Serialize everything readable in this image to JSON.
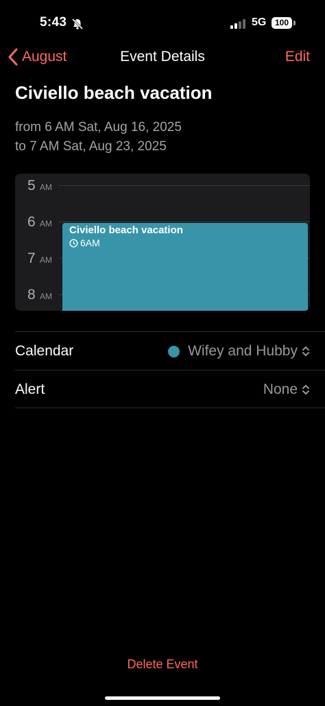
{
  "status": {
    "time": "5:43",
    "network": "5G",
    "battery": "100",
    "bell_icon": "bell-slash-icon",
    "signal_icon": "cellular-signal-icon"
  },
  "nav": {
    "back_label": "August",
    "title": "Event Details",
    "edit_label": "Edit",
    "back_icon": "chevron-left-icon"
  },
  "event": {
    "title": "Civiello beach vacation",
    "from": "from 6 AM Sat, Aug 16, 2025",
    "to": "to 7 AM Sat, Aug 23, 2025"
  },
  "timeline": {
    "hours": [
      {
        "num": "5",
        "ampm": "AM"
      },
      {
        "num": "6",
        "ampm": "AM"
      },
      {
        "num": "7",
        "ampm": "AM"
      },
      {
        "num": "8",
        "ampm": "AM"
      }
    ],
    "block": {
      "title": "Civiello beach vacation",
      "time": "6AM",
      "color": "#3895a9",
      "clock_icon": "clock-icon"
    }
  },
  "details": {
    "calendar_label": "Calendar",
    "calendar_value": "Wifey and Hubby",
    "calendar_color": "#3895a9",
    "alert_label": "Alert",
    "alert_value": "None",
    "chevron_icon": "chevron-up-down-icon"
  },
  "footer": {
    "delete_label": "Delete Event"
  },
  "colors": {
    "accent": "#ff6961",
    "background": "#000000"
  }
}
